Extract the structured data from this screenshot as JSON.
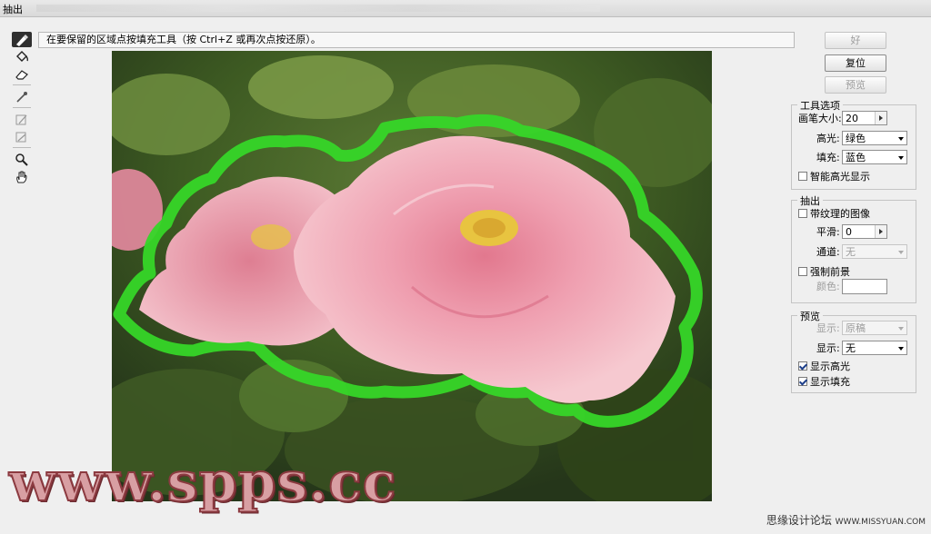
{
  "window": {
    "title": "抽出"
  },
  "instruction": "在要保留的区域点按填充工具（按 Ctrl+Z 或再次点按还原）。",
  "tools": [
    {
      "name": "edge-highlighter-tool",
      "selected": true
    },
    {
      "name": "fill-tool"
    },
    {
      "name": "eraser-tool"
    },
    {
      "name": "eyedropper-tool"
    },
    {
      "name": "cleanup-tool"
    },
    {
      "name": "edge-touchup-tool"
    },
    {
      "name": "zoom-tool"
    },
    {
      "name": "hand-tool"
    }
  ],
  "buttons": {
    "ok": "好",
    "reset": "复位",
    "preview": "预览"
  },
  "tool_options": {
    "title": "工具选项",
    "brush_size_label": "画笔大小:",
    "brush_size_value": "20",
    "highlight_label": "高光:",
    "highlight_value": "绿色",
    "fill_label": "填充:",
    "fill_value": "蓝色",
    "smart_highlight_label": "智能高光显示",
    "smart_highlight_checked": false
  },
  "extraction": {
    "title": "抽出",
    "textured_label": "带纹理的图像",
    "textured_checked": false,
    "smooth_label": "平滑:",
    "smooth_value": "0",
    "channel_label": "通道:",
    "channel_value": "无",
    "force_fg_label": "强制前景",
    "force_fg_checked": false,
    "color_label": "颜色:"
  },
  "preview_group": {
    "title": "预览",
    "show1_label": "显示:",
    "show1_value": "原稿",
    "show2_label": "显示:",
    "show2_value": "无",
    "show_highlight_label": "显示高光",
    "show_highlight_checked": true,
    "show_fill_label": "显示填充",
    "show_fill_checked": true
  },
  "colors": {
    "highlight": "#3ddc2a",
    "background": "#efefef"
  },
  "watermark": "www.spps.cc",
  "credit": {
    "text": "思缘设计论坛",
    "site": "WWW.MISSYUAN.COM"
  }
}
